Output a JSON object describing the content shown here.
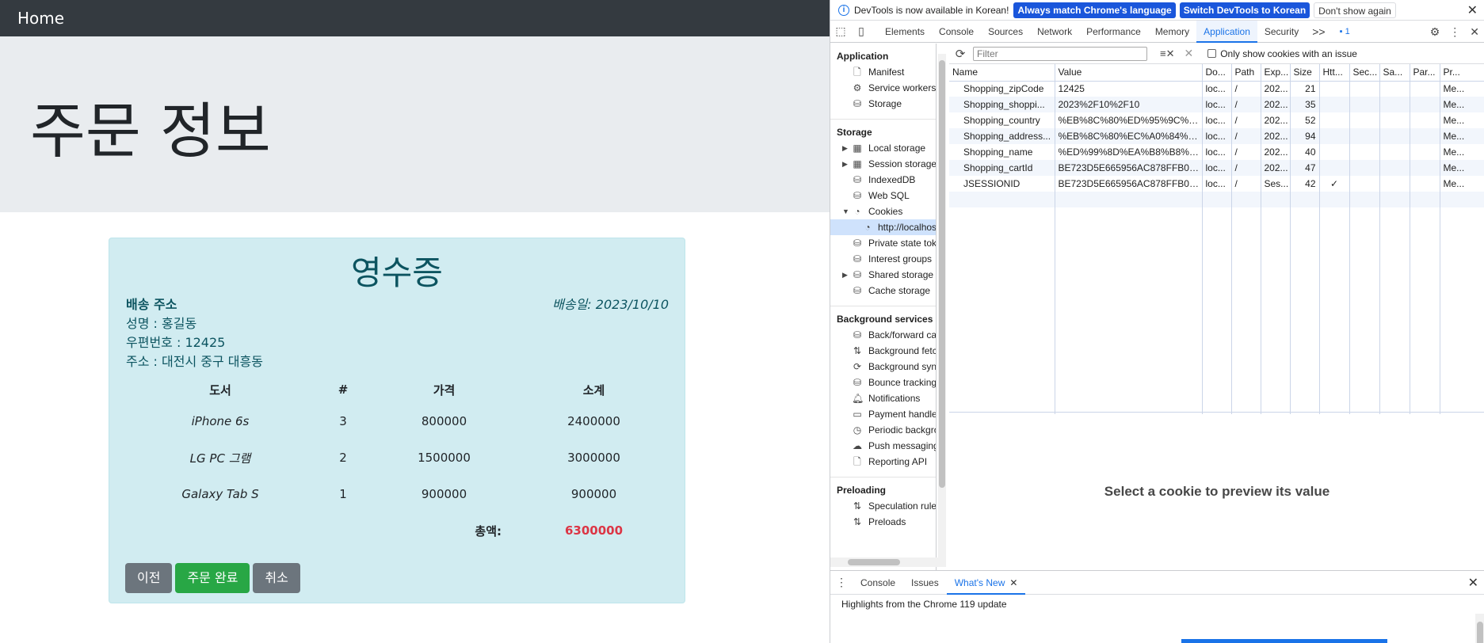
{
  "page": {
    "navbar": {
      "brand": "Home"
    },
    "jumbotron": {
      "title": "주문 정보"
    },
    "receipt": {
      "title": "영수증",
      "shipping_label": "배송 주소",
      "shipping_date": "배송일: 2023/10/10",
      "name_line": "성명 : 홍길동",
      "zip_line": "우편번호 : 12425",
      "address_line": "주소 : 대전시 중구 대흥동",
      "table_headers": [
        "도서",
        "#",
        "가격",
        "소계"
      ],
      "rows": [
        {
          "book": "iPhone 6s",
          "qty": "3",
          "price": "800000",
          "subtotal": "2400000"
        },
        {
          "book": "LG PC 그램",
          "qty": "2",
          "price": "1500000",
          "subtotal": "3000000"
        },
        {
          "book": "Galaxy Tab S",
          "qty": "1",
          "price": "900000",
          "subtotal": "900000"
        }
      ],
      "total_label": "총액:",
      "total_value": "6300000",
      "buttons": {
        "prev": "이전",
        "complete": "주문 완료",
        "cancel": "취소"
      }
    }
  },
  "devtools": {
    "infobar": {
      "message": "DevTools is now available in Korean!",
      "btn_match": "Always match Chrome's language",
      "btn_switch": "Switch DevTools to Korean",
      "btn_dont_show": "Don't show again"
    },
    "tabs": [
      "Elements",
      "Console",
      "Sources",
      "Network",
      "Performance",
      "Memory",
      "Application",
      "Security"
    ],
    "active_tab": "Application",
    "more_tabs": ">>",
    "issues_count": "1",
    "sidebar": {
      "application_header": "Application",
      "application_items": [
        "Manifest",
        "Service workers",
        "Storage"
      ],
      "storage_header": "Storage",
      "storage_items": [
        "Local storage",
        "Session storage",
        "IndexedDB",
        "Web SQL",
        "Cookies"
      ],
      "cookie_origin": "http://localhost",
      "storage_items_after": [
        "Private state tokens",
        "Interest groups",
        "Shared storage",
        "Cache storage"
      ],
      "bg_header": "Background services",
      "bg_items": [
        "Back/forward cache",
        "Background fetch",
        "Background sync",
        "Bounce tracking",
        "Notifications",
        "Payment handler",
        "Periodic background sync",
        "Push messaging",
        "Reporting API"
      ],
      "preload_header": "Preloading",
      "preload_items": [
        "Speculation rules",
        "Preloads"
      ]
    },
    "cookies": {
      "filter_placeholder": "Filter",
      "only_issues_label": "Only show cookies with an issue",
      "columns": [
        "Name",
        "Value",
        "Do...",
        "Path",
        "Exp...",
        "Size",
        "Htt...",
        "Sec...",
        "Sa...",
        "Par...",
        "Pr..."
      ],
      "rows": [
        {
          "name": "Shopping_zipCode",
          "value": "12425",
          "domain": "loc...",
          "path": "/",
          "expires": "202...",
          "size": "21",
          "http": "",
          "priority": "Me..."
        },
        {
          "name": "Shopping_shoppi...",
          "value": "2023%2F10%2F10",
          "domain": "loc...",
          "path": "/",
          "expires": "202...",
          "size": "35",
          "http": "",
          "priority": "Me..."
        },
        {
          "name": "Shopping_country",
          "value": "%EB%8C%80%ED%95%9C%EB...",
          "domain": "loc...",
          "path": "/",
          "expires": "202...",
          "size": "52",
          "http": "",
          "priority": "Me..."
        },
        {
          "name": "Shopping_address...",
          "value": "%EB%8C%80%EC%A0%84%EC...",
          "domain": "loc...",
          "path": "/",
          "expires": "202...",
          "size": "94",
          "http": "",
          "priority": "Me..."
        },
        {
          "name": "Shopping_name",
          "value": "%ED%99%8D%EA%B8%B8%EB...",
          "domain": "loc...",
          "path": "/",
          "expires": "202...",
          "size": "40",
          "http": "",
          "priority": "Me..."
        },
        {
          "name": "Shopping_cartId",
          "value": "BE723D5E665956AC878FFB0C...",
          "domain": "loc...",
          "path": "/",
          "expires": "202...",
          "size": "47",
          "http": "",
          "priority": "Me..."
        },
        {
          "name": "JSESSIONID",
          "value": "BE723D5E665956AC878FFB0C...",
          "domain": "loc...",
          "path": "/",
          "expires": "Ses...",
          "size": "42",
          "http": "✓",
          "priority": "Me..."
        }
      ],
      "preview_text": "Select a cookie to preview its value"
    },
    "drawer": {
      "tabs": [
        "Console",
        "Issues",
        "What's New"
      ],
      "active_tab": "What's New",
      "highlights": "Highlights from the Chrome 119 update"
    }
  }
}
